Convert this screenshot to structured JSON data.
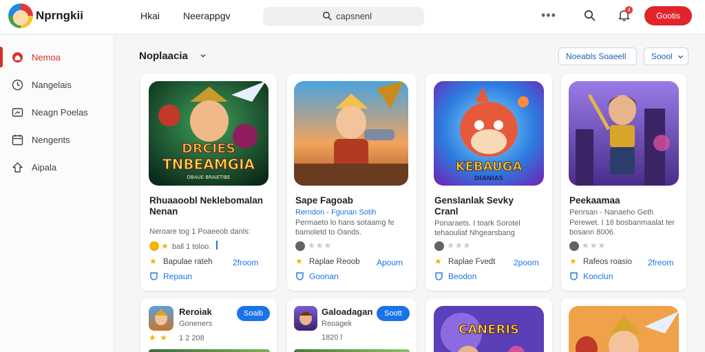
{
  "header": {
    "brand": "Nprngkii",
    "links": [
      "Hkai",
      "Neerappgv"
    ],
    "search_placeholder": "capsnenl",
    "notification_count": "4",
    "primary_button": "Gootis"
  },
  "sidebar": {
    "items": [
      {
        "label": "Nemoa",
        "icon": "home-icon",
        "active": true
      },
      {
        "label": "Nangelais",
        "icon": "clock-icon",
        "active": false
      },
      {
        "label": "Neagn Poelas",
        "icon": "media-icon",
        "active": false
      },
      {
        "label": "Nengents",
        "icon": "calendar-icon",
        "active": false
      },
      {
        "label": "Aipala",
        "icon": "puzzle-icon",
        "active": false
      }
    ]
  },
  "section": {
    "title": "Noplaacia",
    "button_1": "Noeabls Soaeell",
    "button_2": "Soool"
  },
  "cards": [
    {
      "title_1": "Rhuaaoobl Neklebomalan",
      "title_2": "Nenan",
      "desc_1": "Neroare tog 1 Poaeeob danls:",
      "desc_2": "",
      "rating_text": "ball 1 toloo.",
      "stars_on": 2,
      "meta": "Bapulae rateh",
      "meta_link": "2froom",
      "link": "Repaun",
      "art_text_1": "DRCIES",
      "art_text_2": "TNBEAMGIA",
      "art_text_3": "DBAUE BRAIETIBE"
    },
    {
      "title_1": "Sape Fagoab",
      "title_2": "",
      "desc_1": "Rerndon - Fgunan Sotih",
      "desc_2": "Permaeto lo hans sotaamg fe",
      "desc_3": "bamoletd to Oands.",
      "stars_on": 0,
      "meta": "Raplae Reoob",
      "meta_link": "Apoum",
      "link": "Goonan"
    },
    {
      "title_1": "Genslanlak Sevky",
      "title_2": "Cranl",
      "desc_1": "Ponaraets. I toark Sorotel",
      "desc_2": "tehaouliaf Nhgearsbang",
      "stars_on": 0,
      "meta": "Raplae Fvedt",
      "meta_link": "2poom",
      "link": "Beodon",
      "art_text_1": "KEBAUGA",
      "art_text_2": "DIANIAS"
    },
    {
      "title_1": "Peekaamaa",
      "title_2": "",
      "desc_1": "Penrsan - Nanaeho Geth",
      "desc_2": "Perewet. I 16 bosbanmaalat ter",
      "desc_3": "bosann 8006.",
      "stars_on": 0,
      "meta": "Rafeos roasio",
      "meta_link": "2freom",
      "link": "Konclun"
    }
  ],
  "small_cards": [
    {
      "title": "Reroiak",
      "sub": "Goneners",
      "meta": "1 2 208",
      "button": "Soaib",
      "stars_on": 2
    },
    {
      "title": "Galoadagan",
      "sub": "Reoagek",
      "meta": "1820 l",
      "button": "Soott",
      "stars_on": 0
    }
  ],
  "art_cards": [
    {
      "art_text": "CANERIS"
    },
    {
      "art_text": ""
    }
  ],
  "colors": {
    "accent_red": "#e0242b",
    "link_blue": "#1a73e8",
    "star_gold": "#f4b400"
  }
}
